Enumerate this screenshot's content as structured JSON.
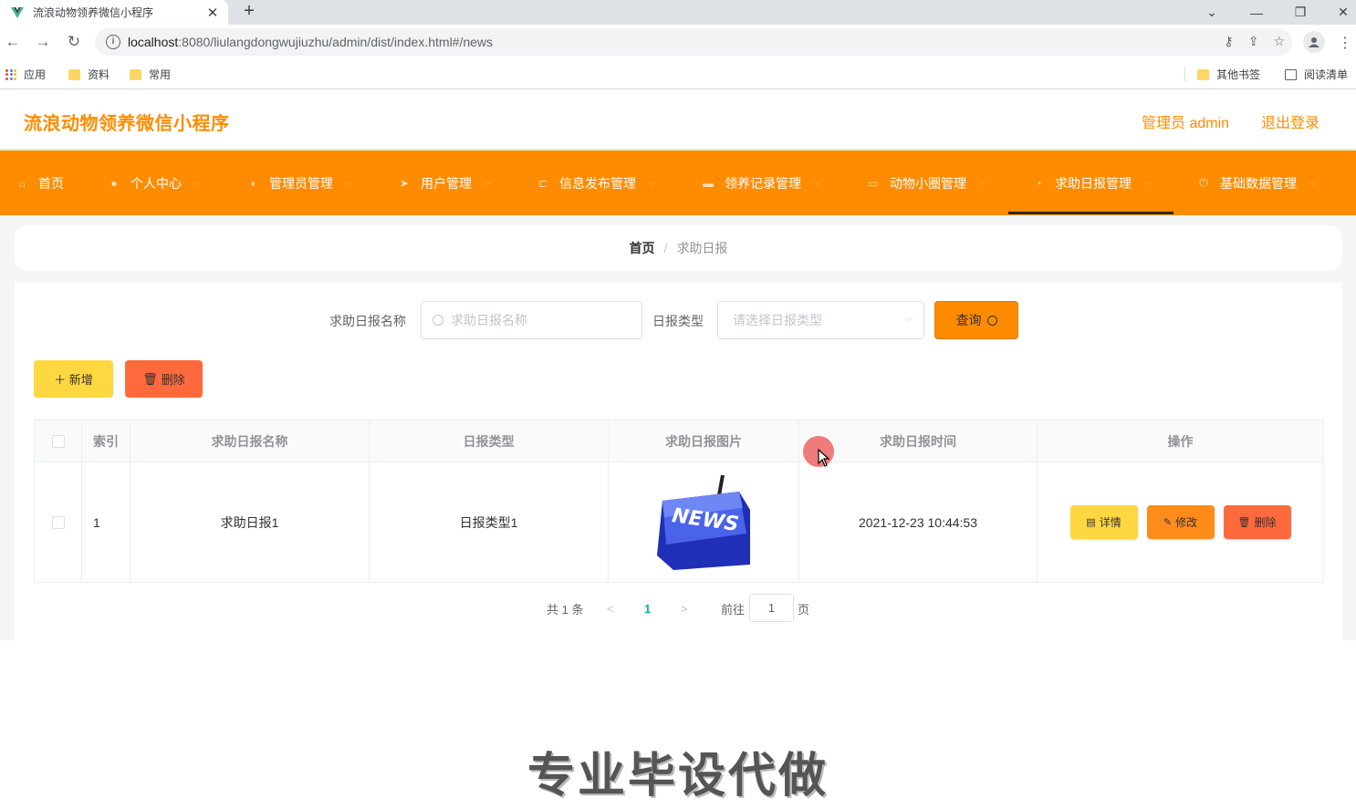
{
  "browser": {
    "tab_title": "流浪动物领养微信小程序",
    "tab_close": "✕",
    "new_tab": "+",
    "url_host": "localhost",
    "url_path": ":8080/liulangdongwujiuzhu/admin/dist/index.html#/news",
    "bookmarks": [
      {
        "label": "应用",
        "icon": "apps-icon"
      },
      {
        "label": "资料",
        "icon": "folder-icon"
      },
      {
        "label": "常用",
        "icon": "folder-icon"
      }
    ],
    "bookmarks_right": [
      {
        "label": "其他书签",
        "icon": "folder-icon"
      },
      {
        "label": "阅读清单",
        "icon": "reading-list-icon"
      }
    ]
  },
  "header": {
    "app_title": "流浪动物领养微信小程序",
    "admin_label": "管理员 admin",
    "logout_label": "退出登录",
    "accent_color": "#ff8c00"
  },
  "nav": {
    "items": [
      {
        "label": "首页",
        "icon": "home-icon"
      },
      {
        "label": "个人中心",
        "icon": "user-icon"
      },
      {
        "label": "管理员管理",
        "icon": "mic-icon"
      },
      {
        "label": "用户管理",
        "icon": "send-icon"
      },
      {
        "label": "信息发布管理",
        "icon": "crop-icon"
      },
      {
        "label": "领养记录管理",
        "icon": "chat-icon"
      },
      {
        "label": "动物小圈管理",
        "icon": "message-icon"
      },
      {
        "label": "求助日报管理",
        "icon": "clock-icon"
      },
      {
        "label": "基础数据管理",
        "icon": "power-icon"
      }
    ],
    "active_index": 7
  },
  "breadcrumb": {
    "home": "首页",
    "separator": "/",
    "current": "求助日报"
  },
  "search": {
    "name_label": "求助日报名称",
    "name_placeholder": "求助日报名称",
    "type_label": "日报类型",
    "type_placeholder": "请选择日报类型",
    "query_button": "查询"
  },
  "actions": {
    "add_button": "＋ 新增",
    "delete_button": "删除"
  },
  "table": {
    "columns": [
      "索引",
      "求助日报名称",
      "日报类型",
      "求助日报图片",
      "求助日报时间",
      "操作"
    ],
    "rows": [
      {
        "index": "1",
        "name": "求助日报1",
        "type": "日报类型1",
        "image_text": "NEWS",
        "time": "2021-12-23 10:44:53",
        "ops": {
          "detail": "详情",
          "edit": "修改",
          "delete": "删除"
        }
      }
    ]
  },
  "pagination": {
    "total": "共 1 条",
    "prev": "<",
    "current_page": "1",
    "next": ">",
    "goto_label": "前往",
    "goto_value": "1",
    "page_suffix": "页"
  },
  "watermark": "专业毕设代做",
  "colors": {
    "nav_bg": "#ff8c00",
    "add_btn": "#ffd740",
    "del_btn": "#ff6a3d",
    "edit_btn": "#ff8c1a",
    "active_page": "#13ae9c"
  }
}
